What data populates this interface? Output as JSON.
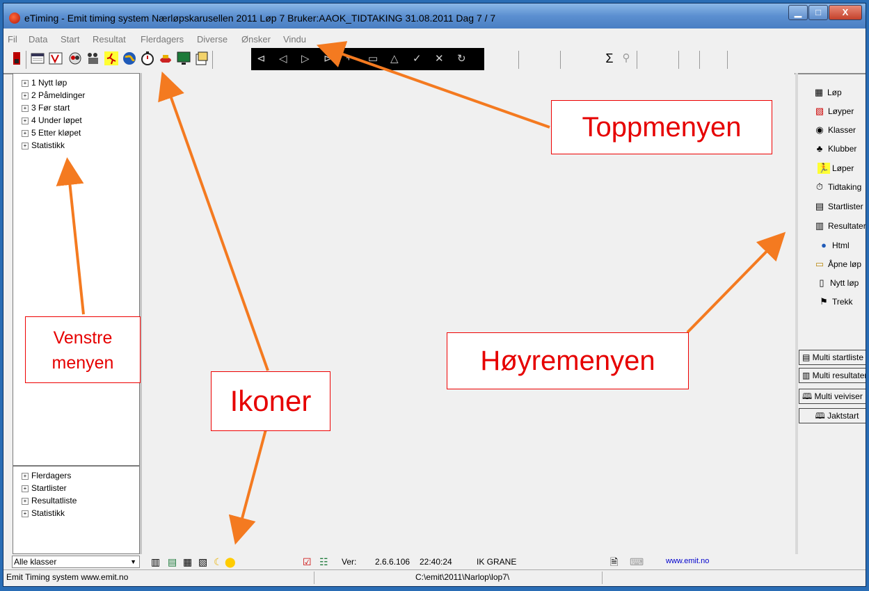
{
  "window": {
    "title": "eTiming - Emit timing system  Nærløpskarusellen 2011 Løp 7   Bruker:AAOK_TIDTAKING   31.08.2011   Dag 7 / 7",
    "minimize": "▁",
    "maximize": "□",
    "close": "X"
  },
  "menubar": [
    "Fil",
    "Data",
    "Start",
    "Resultat",
    "Flerdagers",
    "Diverse",
    "Ønsker",
    "Vindu"
  ],
  "toolbar": {
    "sigma": "Σ",
    "binoculars": "⚲"
  },
  "left_tree_top": [
    "1 Nytt løp",
    "2 Påmeldinger",
    "3 Før start",
    "4 Under løpet",
    "5 Etter kløpet",
    "Statistikk"
  ],
  "left_tree_bottom": [
    "Flerdagers",
    "Startlister",
    "Resultatliste",
    "Statistikk"
  ],
  "right_menu": [
    {
      "label": "Løp",
      "icon": "calendar-icon"
    },
    {
      "label": "Løyper",
      "icon": "map-icon"
    },
    {
      "label": "Klasser",
      "icon": "people-icon"
    },
    {
      "label": "Klubber",
      "icon": "club-icon"
    },
    {
      "label": "Løper",
      "icon": "runner-icon"
    },
    {
      "label": "Tidtaking",
      "icon": "stopwatch-icon"
    },
    {
      "label": "Startlister",
      "icon": "startlist-icon"
    },
    {
      "label": "Resultater",
      "icon": "results-icon"
    },
    {
      "label": "Html",
      "icon": "globe-icon"
    },
    {
      "label": "Åpne løp",
      "icon": "folder-open-icon"
    },
    {
      "label": "Nytt løp",
      "icon": "new-file-icon"
    },
    {
      "label": "Trekk",
      "icon": "draw-icon"
    }
  ],
  "multi_buttons": [
    "Multi startliste",
    "Multi resultater",
    "Multi veiviser",
    "Jaktstart"
  ],
  "bottombar": {
    "class_select": "Alle klasser",
    "ver_label": "Ver:",
    "version": "2.6.6.106",
    "time": "22:40:24",
    "club": "IK GRANE",
    "website": "www.emit.no"
  },
  "statusbar": {
    "left": "Emit Timing system www.emit.no",
    "path": "C:\\emit\\2011\\Narlop\\lop7\\"
  },
  "annotations": {
    "toppmenyen": "Toppmenyen",
    "venstre": "Venstre menyen",
    "venstre_line1": "Venstre",
    "venstre_line2": "menyen",
    "ikoner": "Ikoner",
    "hoyremenyen": "Høyremenyen"
  },
  "colors": {
    "annotation_text": "#e60000",
    "arrow": "#f47a20",
    "link": "#0000cc"
  }
}
